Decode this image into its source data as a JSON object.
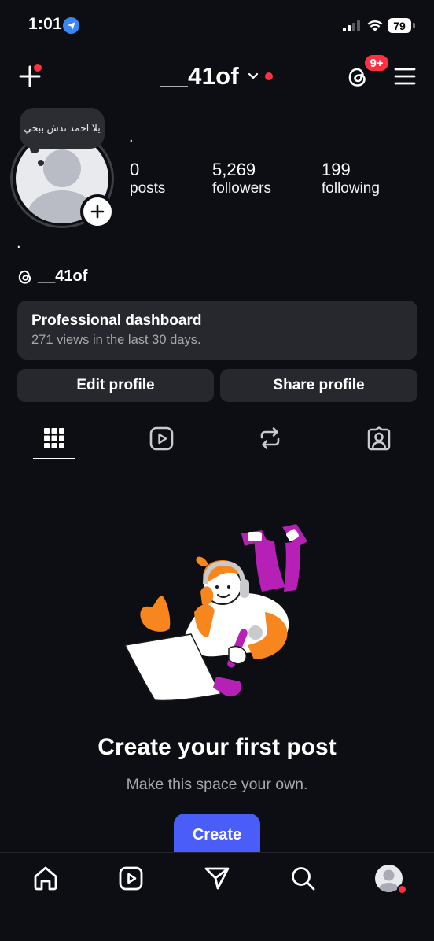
{
  "status_bar": {
    "time": "1:01",
    "battery": "79",
    "icons": [
      "location-icon",
      "signal-icon",
      "wifi-icon",
      "battery-icon"
    ]
  },
  "header": {
    "username": "__41of",
    "notification_badge": "9+",
    "icons": [
      "plus-icon",
      "chevron-down-icon",
      "threads-icon",
      "menu-icon"
    ]
  },
  "profile": {
    "note": "يلا احمد ندش ببجي",
    "name": ".",
    "bio": ".",
    "threads_handle": "__41of",
    "stats": [
      {
        "value": "0",
        "label": "posts"
      },
      {
        "value": "5,269",
        "label": "followers"
      },
      {
        "value": "199",
        "label": "following"
      }
    ]
  },
  "dashboard": {
    "title": "Professional dashboard",
    "subtitle": "271 views in the last 30 days."
  },
  "actions": {
    "edit_label": "Edit profile",
    "share_label": "Share profile"
  },
  "tabs": [
    "grid-icon",
    "reels-icon",
    "reposts-icon",
    "tagged-icon"
  ],
  "empty_state": {
    "title": "Create your first post",
    "subtitle": "Make this space your own.",
    "button": "Create"
  },
  "bottom_nav": [
    "home-icon",
    "reels-icon",
    "send-icon",
    "search-icon",
    "profile-icon"
  ],
  "colors": {
    "background": "#0c0e13",
    "card": "#26282e",
    "accent": "#4a5df9",
    "badge": "#ff3040"
  }
}
